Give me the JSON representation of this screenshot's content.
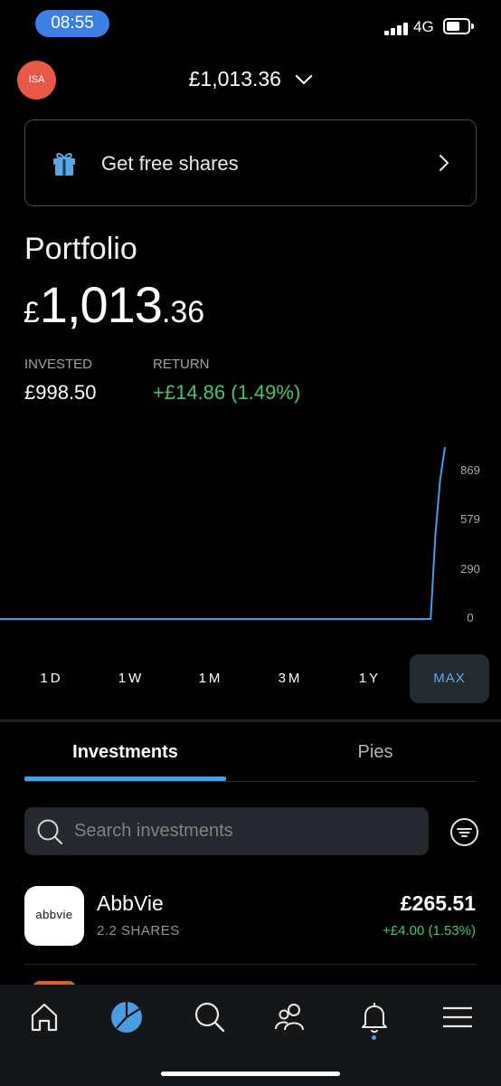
{
  "status_bar": {
    "time": "08:55",
    "network": "4G"
  },
  "header": {
    "account_badge": "ISA",
    "total_value": "£1,013.36",
    "dropdown_icon": "chevron-down-icon"
  },
  "promo": {
    "label": "Get free shares",
    "icon": "gift-icon",
    "arrow_icon": "chevron-right-icon"
  },
  "portfolio": {
    "title": "Portfolio",
    "currency": "£",
    "value_main": "1,013",
    "value_decimal": ".36",
    "invested_label": "INVESTED",
    "invested_value": "£998.50",
    "return_label": "RETURN",
    "return_value": "+£14.86 (1.49%)"
  },
  "chart_data": {
    "type": "line",
    "title": "",
    "xlabel": "",
    "ylabel": "",
    "y_ticks": [
      "869",
      "579",
      "290",
      "0"
    ],
    "ylim": [
      0,
      1013
    ],
    "grid": false,
    "series": [
      {
        "color": "#4a9de0",
        "points": [
          [
            0,
            0
          ],
          [
            1,
            0
          ],
          [
            2,
            0
          ],
          [
            3,
            0
          ],
          [
            4,
            0
          ],
          [
            5,
            0
          ],
          [
            6,
            0
          ],
          [
            7,
            0
          ],
          [
            8,
            0
          ],
          [
            9,
            0
          ],
          [
            10,
            0
          ],
          [
            11,
            0
          ],
          [
            12,
            0
          ],
          [
            13,
            0
          ],
          [
            14,
            0
          ],
          [
            15,
            0
          ],
          [
            16,
            0
          ],
          [
            17,
            0
          ],
          [
            18,
            0
          ],
          [
            18.1,
            0
          ],
          [
            18.3,
            500
          ],
          [
            18.5,
            820
          ],
          [
            18.7,
            1013
          ]
        ]
      }
    ]
  },
  "timeframes": [
    {
      "label": "1D",
      "active": false
    },
    {
      "label": "1W",
      "active": false
    },
    {
      "label": "1M",
      "active": false
    },
    {
      "label": "3M",
      "active": false
    },
    {
      "label": "1Y",
      "active": false
    },
    {
      "label": "MAX",
      "active": true
    }
  ],
  "tabs": [
    {
      "label": "Investments",
      "active": true
    },
    {
      "label": "Pies",
      "active": false
    }
  ],
  "search": {
    "placeholder": "Search investments"
  },
  "holdings": [
    {
      "logo_text": "abbvie",
      "name": "AbbVie",
      "shares": "2.2 SHARES",
      "value": "£265.51",
      "change": "+£4.00 (1.53%)"
    }
  ],
  "bottom_nav": [
    {
      "icon": "home-icon",
      "active": false
    },
    {
      "icon": "pie-chart-icon",
      "active": true
    },
    {
      "icon": "search-icon",
      "active": false
    },
    {
      "icon": "community-icon",
      "active": false
    },
    {
      "icon": "bell-icon",
      "active": false
    },
    {
      "icon": "menu-icon",
      "active": false
    }
  ],
  "colors": {
    "accent": "#4a9de0",
    "positive": "#47c46a",
    "badge": "#e9594a",
    "background": "#000000"
  }
}
